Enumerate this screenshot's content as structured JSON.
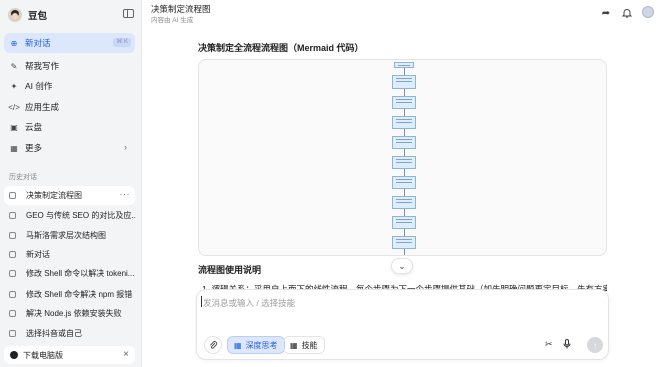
{
  "sidebar": {
    "app_name": "豆包",
    "toggle_icon": "sidebar-toggle-icon",
    "nav": [
      {
        "label": "新对话",
        "icon": "chat-plus-icon",
        "shortcut": "⌘ K"
      },
      {
        "label": "帮我写作",
        "icon": "pen-icon"
      },
      {
        "label": "AI 创作",
        "icon": "sparkle-icon"
      },
      {
        "label": "应用生成",
        "icon": "code-icon"
      },
      {
        "label": "云盘",
        "icon": "cloud-drive-icon"
      },
      {
        "label": "更多",
        "icon": "grid-icon"
      }
    ],
    "history_label": "历史对话",
    "history": [
      "决策制定流程图",
      "GEO 与传统 SEO 的对比及应...",
      "马斯洛需求层次结构图",
      "新对话",
      "修改 Shell 命令以解决 tokeni...",
      "修改 Shell 命令解决 npm 报错",
      "解决 Node.js 依赖安装失败",
      "选择抖音或自己"
    ],
    "download_label": "下载电脑版"
  },
  "header": {
    "title": "决策制定流程图",
    "subtitle": "内容由 AI 生成"
  },
  "content": {
    "section_title": "决策制定全流程流程图（Mermaid 代码）",
    "usage_title": "流程图使用说明",
    "usage_line": "1. 逻辑关系：采用自上而下的线性流程，每个步骤为下一个步骤提供基础（如先明确问题再定目标，先有方案再"
  },
  "input": {
    "placeholder": "发消息或输入 / 选择技能",
    "deep_think_label": "深度思考",
    "skills_label": "技能"
  },
  "colors": {
    "accent": "#1f5ee0",
    "active_bg": "#dde7fb",
    "sidebar_bg": "#f3f4f6",
    "node_fill": "#dceefe"
  }
}
